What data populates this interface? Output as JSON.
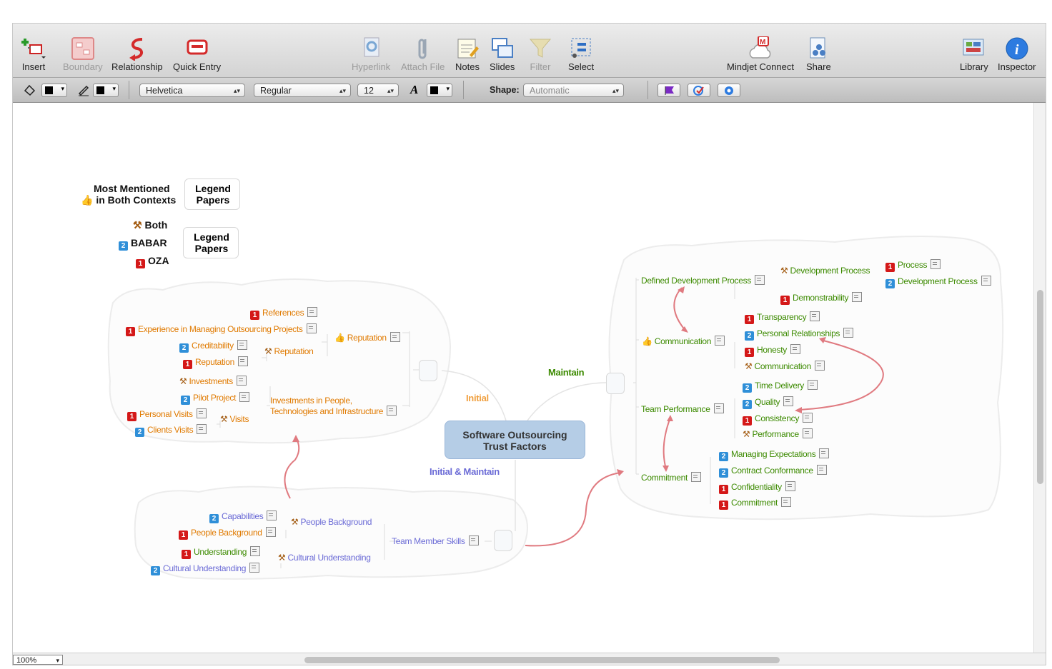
{
  "toolbar": {
    "insert": "Insert",
    "boundary": "Boundary",
    "relationship": "Relationship",
    "quick_entry": "Quick Entry",
    "hyperlink": "Hyperlink",
    "attach_file": "Attach File",
    "notes": "Notes",
    "slides": "Slides",
    "filter": "Filter",
    "select": "Select",
    "mindjet_connect": "Mindjet Connect",
    "share": "Share",
    "library": "Library",
    "inspector": "Inspector"
  },
  "format": {
    "font": "Helvetica",
    "style": "Regular",
    "size": "12",
    "shape_label": "Shape:",
    "shape_value": "Automatic"
  },
  "zoom": "100%",
  "legend": {
    "most_mentioned": "Most Mentioned",
    "in_both": "in Both Contexts",
    "legend_papers": "Legend Papers",
    "both": "Both",
    "babar": "BABAR",
    "oza": "OZA",
    "badge1": "1",
    "badge2": "2"
  },
  "central": {
    "title": "Software Outsourcing Trust Factors"
  },
  "branches": {
    "initial": "Initial",
    "maintain": "Maintain",
    "initial_maintain": "Initial & Maintain"
  },
  "initial": {
    "references": "References",
    "experience": "Experience in Managing Outsourcing Projects",
    "creditability": "Creditability",
    "reputation_sub": "Reputation",
    "reputation_both": "Reputation",
    "reputation_top": "Reputation",
    "investments": "Investments",
    "pilot_project": "Pilot Project",
    "investments_people": "Investments in People,",
    "investments_people2": "Technologies and Infrastructure",
    "personal_visits": "Personal Visits",
    "clients_visits": "Clients Visits",
    "visits": "Visits"
  },
  "initial_maintain": {
    "capabilities": "Capabilities",
    "people_background_sub": "People Background",
    "people_background": "People Background",
    "understanding": "Understanding",
    "cultural_understanding_sub": "Cultural Understanding",
    "cultural_understanding": "Cultural Understanding",
    "team_member_skills": "Team Member Skills"
  },
  "maintain": {
    "defined_dev_process": "Defined Development Process",
    "development_process_both": "Development Process",
    "process": "Process",
    "development_process": "Development Process",
    "demonstrability": "Demonstrability",
    "communication": "Communication",
    "transparency": "Transparency",
    "personal_relationships": "Personal Relationships",
    "honesty": "Honesty",
    "communication_sub": "Communication",
    "team_performance": "Team Performance",
    "time_delivery": "Time Delivery",
    "quality": "Quality",
    "consistency": "Consistency",
    "performance": "Performance",
    "commitment": "Commitment",
    "managing_expectations": "Managing Expectations",
    "contract_conformance": "Contract Conformance",
    "confidentiality": "Confidentiality",
    "commitment_sub": "Commitment"
  }
}
